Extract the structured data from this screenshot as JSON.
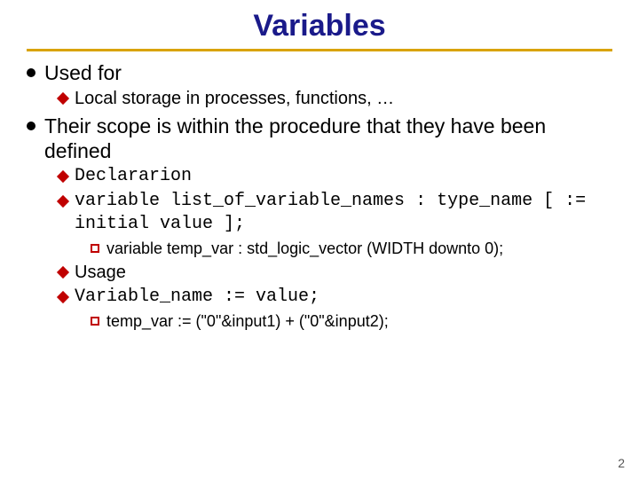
{
  "title": "Variables",
  "items": [
    {
      "level": 1,
      "text": "Used for",
      "mono": false
    },
    {
      "level": 2,
      "text": "Local storage in processes, functions, …",
      "mono": false
    },
    {
      "level": 1,
      "text": " Their scope is within the procedure that they have been defined",
      "mono": false
    },
    {
      "level": 2,
      "text": "Declararion",
      "mono": true
    },
    {
      "level": 2,
      "text": "variable list_of_variable_names : type_name [ := initial value ];",
      "mono": true
    },
    {
      "level": 3,
      "text": "variable temp_var : std_logic_vector (WIDTH downto 0);",
      "mono": false
    },
    {
      "level": 2,
      "text": "Usage",
      "mono": false
    },
    {
      "level": 2,
      "text": "Variable_name := value;",
      "mono": true
    },
    {
      "level": 3,
      "text": " temp_var := (\"0\"&input1) + (\"0\"&input2);",
      "mono": false
    }
  ],
  "page_number": "2"
}
